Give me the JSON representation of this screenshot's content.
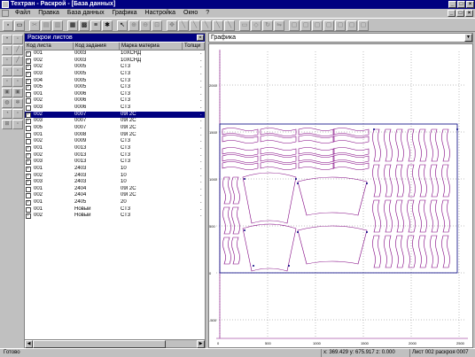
{
  "window": {
    "title": "Техтран - Раскрой - [База данных]",
    "controls": [
      "_",
      "□",
      "×"
    ]
  },
  "menu": {
    "items": [
      "Файл",
      "Правка",
      "База данных",
      "Графика",
      "Настройка",
      "Окно",
      "?"
    ]
  },
  "left_panel": {
    "title": "Раскрои листов",
    "close": "×",
    "columns": [
      "Код листа",
      "Код задания",
      "Марка материа",
      "Толщи"
    ],
    "rows": [
      {
        "icon": "q",
        "sheet": "001",
        "task": "0003",
        "material": "10ХСНД"
      },
      {
        "icon": "q",
        "sheet": "002",
        "task": "0003",
        "material": "10ХСНД"
      },
      {
        "icon": "q",
        "sheet": "002",
        "task": "0005",
        "material": "СТ3"
      },
      {
        "icon": "q",
        "sheet": "003",
        "task": "0005",
        "material": "СТ3"
      },
      {
        "icon": "q",
        "sheet": "004",
        "task": "0005",
        "material": "СТ3"
      },
      {
        "icon": "q",
        "sheet": "005",
        "task": "0005",
        "material": "СТ3"
      },
      {
        "icon": "",
        "sheet": "001",
        "task": "0006",
        "material": "СТ3"
      },
      {
        "icon": "",
        "sheet": "002",
        "task": "0006",
        "material": "СТ3"
      },
      {
        "icon": "",
        "sheet": "003",
        "task": "0006",
        "material": "СТ3"
      },
      {
        "icon": "q",
        "sheet": "002",
        "task": "0007",
        "material": "09Г2С",
        "selected": true
      },
      {
        "icon": "q",
        "sheet": "003",
        "task": "0007",
        "material": "09Г2С"
      },
      {
        "icon": "",
        "sheet": "005",
        "task": "0007",
        "material": "09Г2С"
      },
      {
        "icon": "",
        "sheet": "001",
        "task": "0008",
        "material": "09Г2С"
      },
      {
        "icon": "",
        "sheet": "002",
        "task": "0009",
        "material": "СТ3"
      },
      {
        "icon": "q",
        "sheet": "001",
        "task": "0013",
        "material": "СТ3"
      },
      {
        "icon": "q",
        "sheet": "002",
        "task": "0013",
        "material": "СТ3"
      },
      {
        "icon": "q",
        "sheet": "003",
        "task": "0013",
        "material": "СТ3"
      },
      {
        "icon": "q",
        "sheet": "001",
        "task": "2403",
        "material": "10"
      },
      {
        "icon": "q",
        "sheet": "002",
        "task": "2403",
        "material": "10"
      },
      {
        "icon": "q",
        "sheet": "003",
        "task": "2403",
        "material": "10"
      },
      {
        "icon": "",
        "sheet": "001",
        "task": "2404",
        "material": "09Г2С"
      },
      {
        "icon": "",
        "sheet": "002",
        "task": "2404",
        "material": "09Г2С"
      },
      {
        "icon": "q",
        "sheet": "001",
        "task": "2405",
        "material": "20"
      },
      {
        "icon": "",
        "sheet": "001",
        "task": "Новый",
        "material": "СТ3"
      },
      {
        "icon": "q",
        "sheet": "002",
        "task": "Новый",
        "material": "СТ3"
      }
    ]
  },
  "right_panel": {
    "view_select": "Графика",
    "y_ticks": [
      "2000",
      "1500",
      "1000",
      "500",
      "0",
      "-500"
    ],
    "x_ticks": [
      "0",
      "500",
      "1000",
      "1500",
      "2000",
      "2500"
    ]
  },
  "status": {
    "left": "Готово",
    "coords": "x: 369.429 y: 675.917 z: 0.000",
    "sheet": "Лист 002 раскроя 0007"
  },
  "colors": {
    "title_bg": "#000080",
    "part_outline": "#800080",
    "sheet_outline": "#000080",
    "grid": "#808080"
  }
}
